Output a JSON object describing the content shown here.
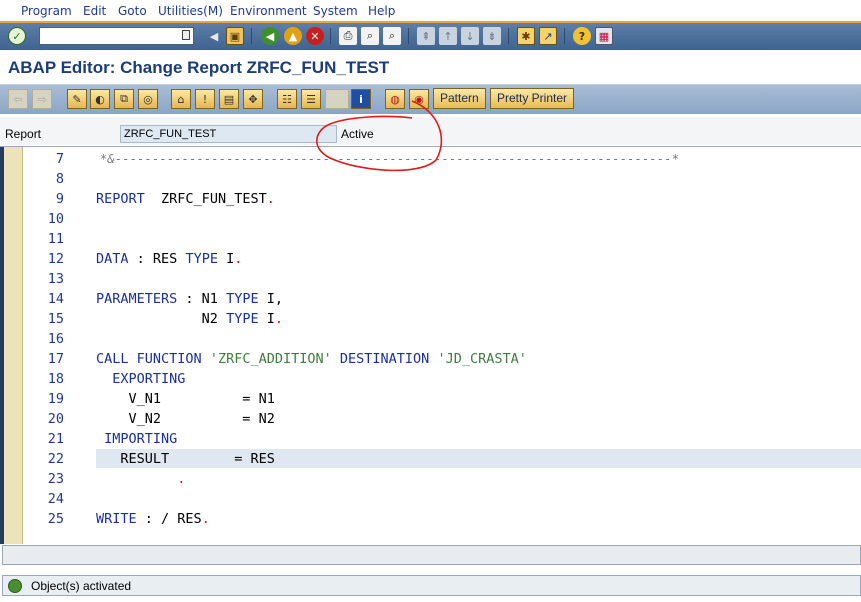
{
  "menu": [
    "Program",
    "Edit",
    "Goto",
    "Utilities(M)",
    "Environment",
    "System",
    "Help"
  ],
  "title": "ABAP Editor: Change Report ZRFC_FUN_TEST",
  "toolbar": {
    "pattern_label": "Pattern",
    "pretty_printer_label": "Pretty Printer"
  },
  "report": {
    "label": "Report",
    "value": "ZRFC_FUN_TEST",
    "status": "Active"
  },
  "editor": {
    "lines": [
      {
        "n": "7",
        "text": "*&---------------------------------------------------------------------------*"
      },
      {
        "n": "8",
        "text": ""
      },
      {
        "n": "9",
        "text": "REPORT  ZRFC_FUN_TEST."
      },
      {
        "n": "10",
        "text": ""
      },
      {
        "n": "11",
        "text": ""
      },
      {
        "n": "12",
        "text": "DATA : RES TYPE I."
      },
      {
        "n": "13",
        "text": ""
      },
      {
        "n": "14",
        "text": "PARAMETERS : N1 TYPE I,"
      },
      {
        "n": "15",
        "text": "             N2 TYPE I."
      },
      {
        "n": "16",
        "text": ""
      },
      {
        "n": "17",
        "text": "CALL FUNCTION 'ZRFC_ADDITION' DESTINATION 'JD_CRASTA'"
      },
      {
        "n": "18",
        "text": "  EXPORTING"
      },
      {
        "n": "19",
        "text": "    V_N1          = N1"
      },
      {
        "n": "20",
        "text": "    V_N2          = N2"
      },
      {
        "n": "21",
        "text": " IMPORTING"
      },
      {
        "n": "22",
        "text": "   RESULT        = RES"
      },
      {
        "n": "23",
        "text": "          ."
      },
      {
        "n": "24",
        "text": ""
      },
      {
        "n": "25",
        "text": "WRITE : / RES."
      }
    ]
  },
  "statusbar": {
    "message": "Object(s) activated"
  }
}
